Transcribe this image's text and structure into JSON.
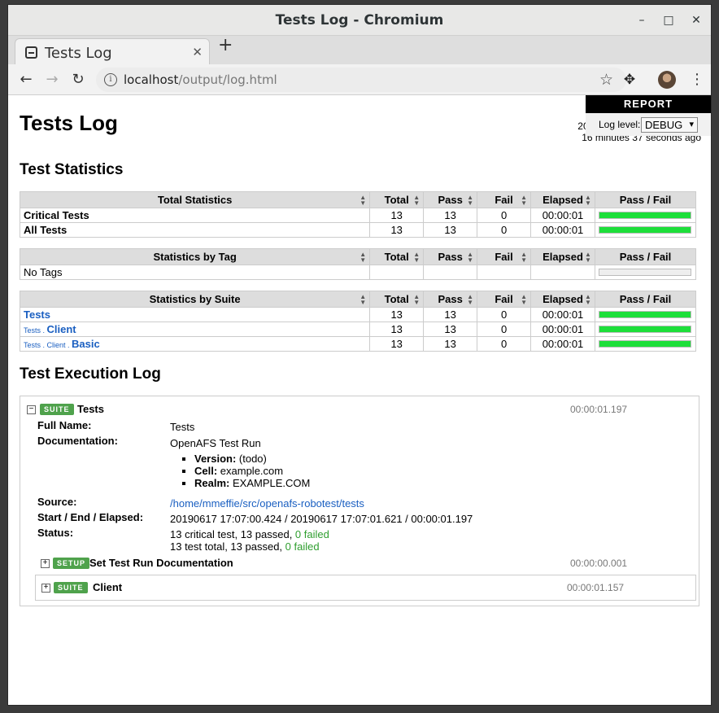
{
  "window": {
    "title": "Tests Log - Chromium",
    "min_label": "–",
    "max_label": "□",
    "close_label": "✕"
  },
  "tabs": [
    {
      "title": "Tests Log",
      "close": "✕"
    }
  ],
  "new_tab_label": "+",
  "nav": {
    "back": "←",
    "forward": "→",
    "reload": "↻"
  },
  "address": {
    "host": "localhost",
    "path": "/output/log.html"
  },
  "page": {
    "title": "Tests Log",
    "generated_line1": "2019",
    "generated_line2": "16 minutes 37 seconds ago",
    "report_link": "REPORT",
    "log_level_label": "Log level:",
    "log_level_value": "DEBUG"
  },
  "statistics": {
    "heading": "Test Statistics",
    "headers": {
      "total": "Total",
      "pass": "Pass",
      "fail": "Fail",
      "elapsed": "Elapsed",
      "graph": "Pass / Fail"
    },
    "total_table": {
      "name_header": "Total Statistics",
      "rows": [
        {
          "name": "Critical Tests",
          "total": "13",
          "pass": "13",
          "fail": "0",
          "elapsed": "00:00:01",
          "pass_fraction": 1.0
        },
        {
          "name": "All Tests",
          "total": "13",
          "pass": "13",
          "fail": "0",
          "elapsed": "00:00:01",
          "pass_fraction": 1.0
        }
      ]
    },
    "tag_table": {
      "name_header": "Statistics by Tag",
      "rows": [
        {
          "name": "No Tags",
          "total": "",
          "pass": "",
          "fail": "",
          "elapsed": "",
          "pass_fraction": 0
        }
      ]
    },
    "suite_table": {
      "name_header": "Statistics by Suite",
      "rows": [
        {
          "parent": "",
          "name": "Tests",
          "total": "13",
          "pass": "13",
          "fail": "0",
          "elapsed": "00:00:01",
          "pass_fraction": 1.0
        },
        {
          "parent": "Tests . ",
          "name": "Client",
          "total": "13",
          "pass": "13",
          "fail": "0",
          "elapsed": "00:00:01",
          "pass_fraction": 1.0
        },
        {
          "parent": "Tests . Client . ",
          "name": "Basic",
          "total": "13",
          "pass": "13",
          "fail": "0",
          "elapsed": "00:00:01",
          "pass_fraction": 1.0
        }
      ]
    }
  },
  "execution": {
    "heading": "Test Execution Log",
    "suite": {
      "toggle": "−",
      "label": "SUITE",
      "name": "Tests",
      "elapsed": "00:00:01.197",
      "full_name_key": "Full Name:",
      "full_name": "Tests",
      "doc_key": "Documentation:",
      "doc_text": "OpenAFS Test Run",
      "doc_items": [
        {
          "key": "Version:",
          "value": " (todo)"
        },
        {
          "key": "Cell:",
          "value": " example.com"
        },
        {
          "key": "Realm:",
          "value": " EXAMPLE.COM"
        }
      ],
      "source_key": "Source:",
      "source": "/home/mmeffie/src/openafs-robotest/tests",
      "times_key": "Start / End / Elapsed:",
      "times": "20190617 17:07:00.424 / 20190617 17:07:01.621 / 00:00:01.197",
      "status_key": "Status:",
      "status_line1": "13 critical test, 13 passed, ",
      "status_line1_fail": "0 failed",
      "status_line2": "13 test total, 13 passed, ",
      "status_line2_fail": "0 failed"
    },
    "setup": {
      "toggle": "+",
      "label": "SETUP",
      "name": "Set Test Run Documentation",
      "elapsed": "00:00:00.001"
    },
    "child_suite": {
      "toggle": "+",
      "label": "SUITE",
      "name": "Client",
      "elapsed": "00:00:01.157"
    }
  },
  "colors": {
    "pass": "#1ddf3a",
    "link": "#1a5fc1",
    "badge": "#4fa24c"
  }
}
